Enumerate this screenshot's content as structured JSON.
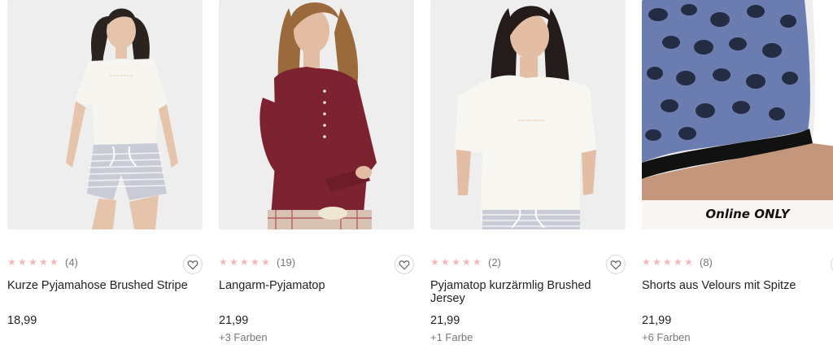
{
  "products": [
    {
      "rating_count": "(4)",
      "name": "Kurze Pyjamahose Brushed Stripe",
      "price": "18,99",
      "colors": ""
    },
    {
      "rating_count": "(19)",
      "name": "Langarm-Pyjamatop",
      "price": "21,99",
      "colors": "+3 Farben"
    },
    {
      "rating_count": "(2)",
      "name": "Pyjamatop kurzärmlig Brushed Jersey",
      "price": "21,99",
      "colors": "+1 Farbe"
    },
    {
      "rating_count": "(8)",
      "name": "Shorts aus Velours mit Spitze",
      "price": "21,99",
      "colors": "+6 Farben",
      "badge": "Online ONLY"
    }
  ],
  "star_glyph": "★",
  "star_color": "#f2b7b9",
  "icons": {
    "wishlist": "heart-outline-icon",
    "rating": "star-icon"
  }
}
